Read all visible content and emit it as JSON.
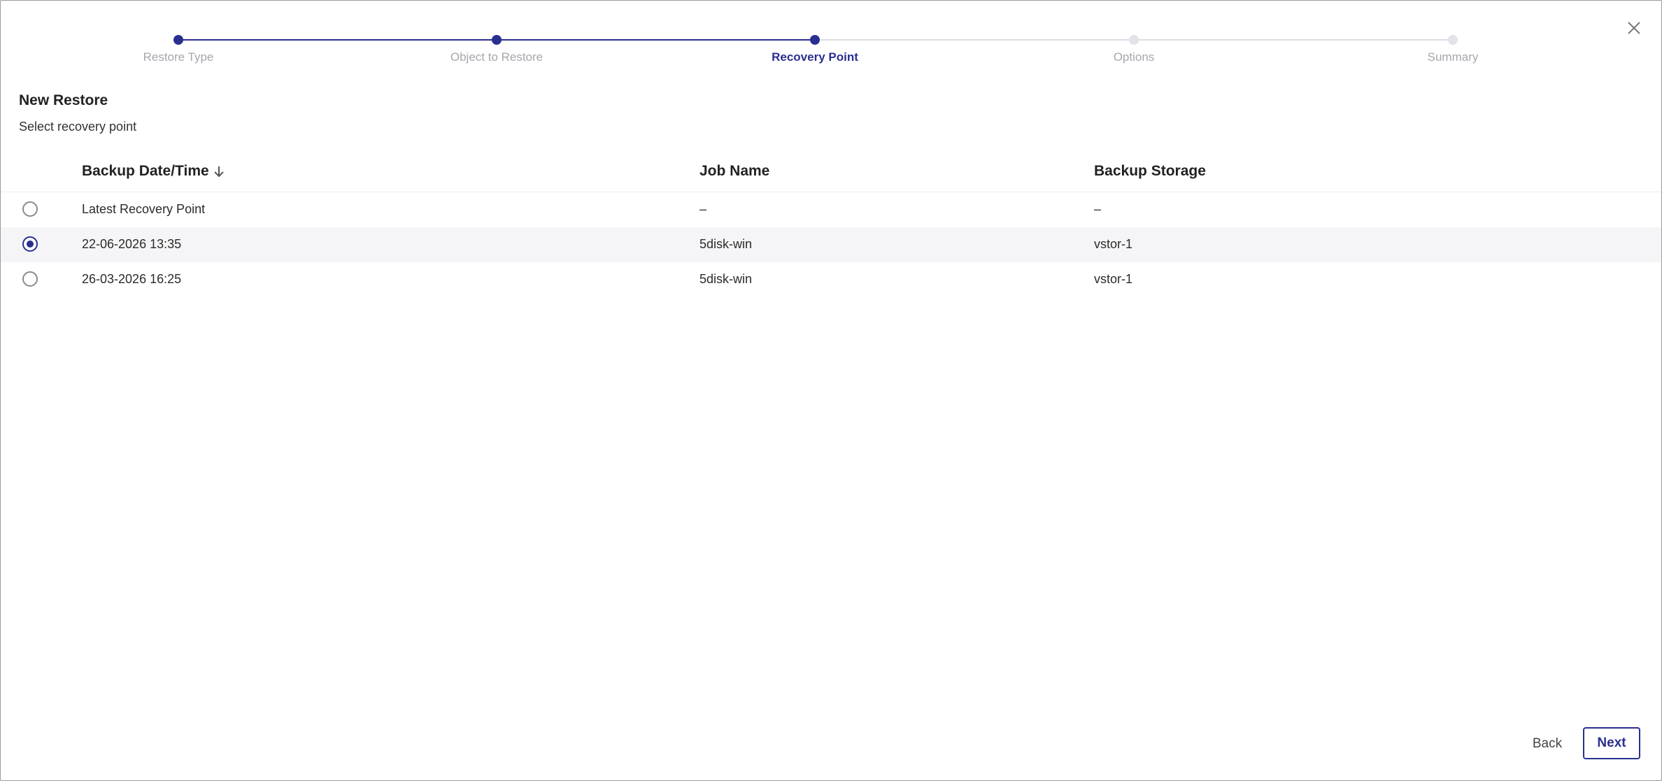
{
  "stepper": {
    "steps": [
      {
        "label": "Restore Type",
        "state": "done"
      },
      {
        "label": "Object to Restore",
        "state": "done"
      },
      {
        "label": "Recovery Point",
        "state": "current"
      },
      {
        "label": "Options",
        "state": "todo"
      },
      {
        "label": "Summary",
        "state": "todo"
      }
    ]
  },
  "dialog": {
    "title": "New Restore",
    "subtitle": "Select recovery point"
  },
  "table": {
    "columns": [
      "Backup Date/Time",
      "Job Name",
      "Backup Storage"
    ],
    "sort_icon": "arrow-down-icon",
    "rows": [
      {
        "date": "Latest Recovery Point",
        "job": "–",
        "storage": "–",
        "selected": false
      },
      {
        "date": "22-06-2026 13:35",
        "job": "5disk-win",
        "storage": "vstor-1",
        "selected": true
      },
      {
        "date": "26-03-2026 16:25",
        "job": "5disk-win",
        "storage": "vstor-1",
        "selected": false
      }
    ]
  },
  "footer": {
    "back_label": "Back",
    "next_label": "Next"
  },
  "colors": {
    "accent": "#2a2f8f",
    "inactive": "#a6a6ad",
    "selected_row": "#f5f5f7"
  }
}
